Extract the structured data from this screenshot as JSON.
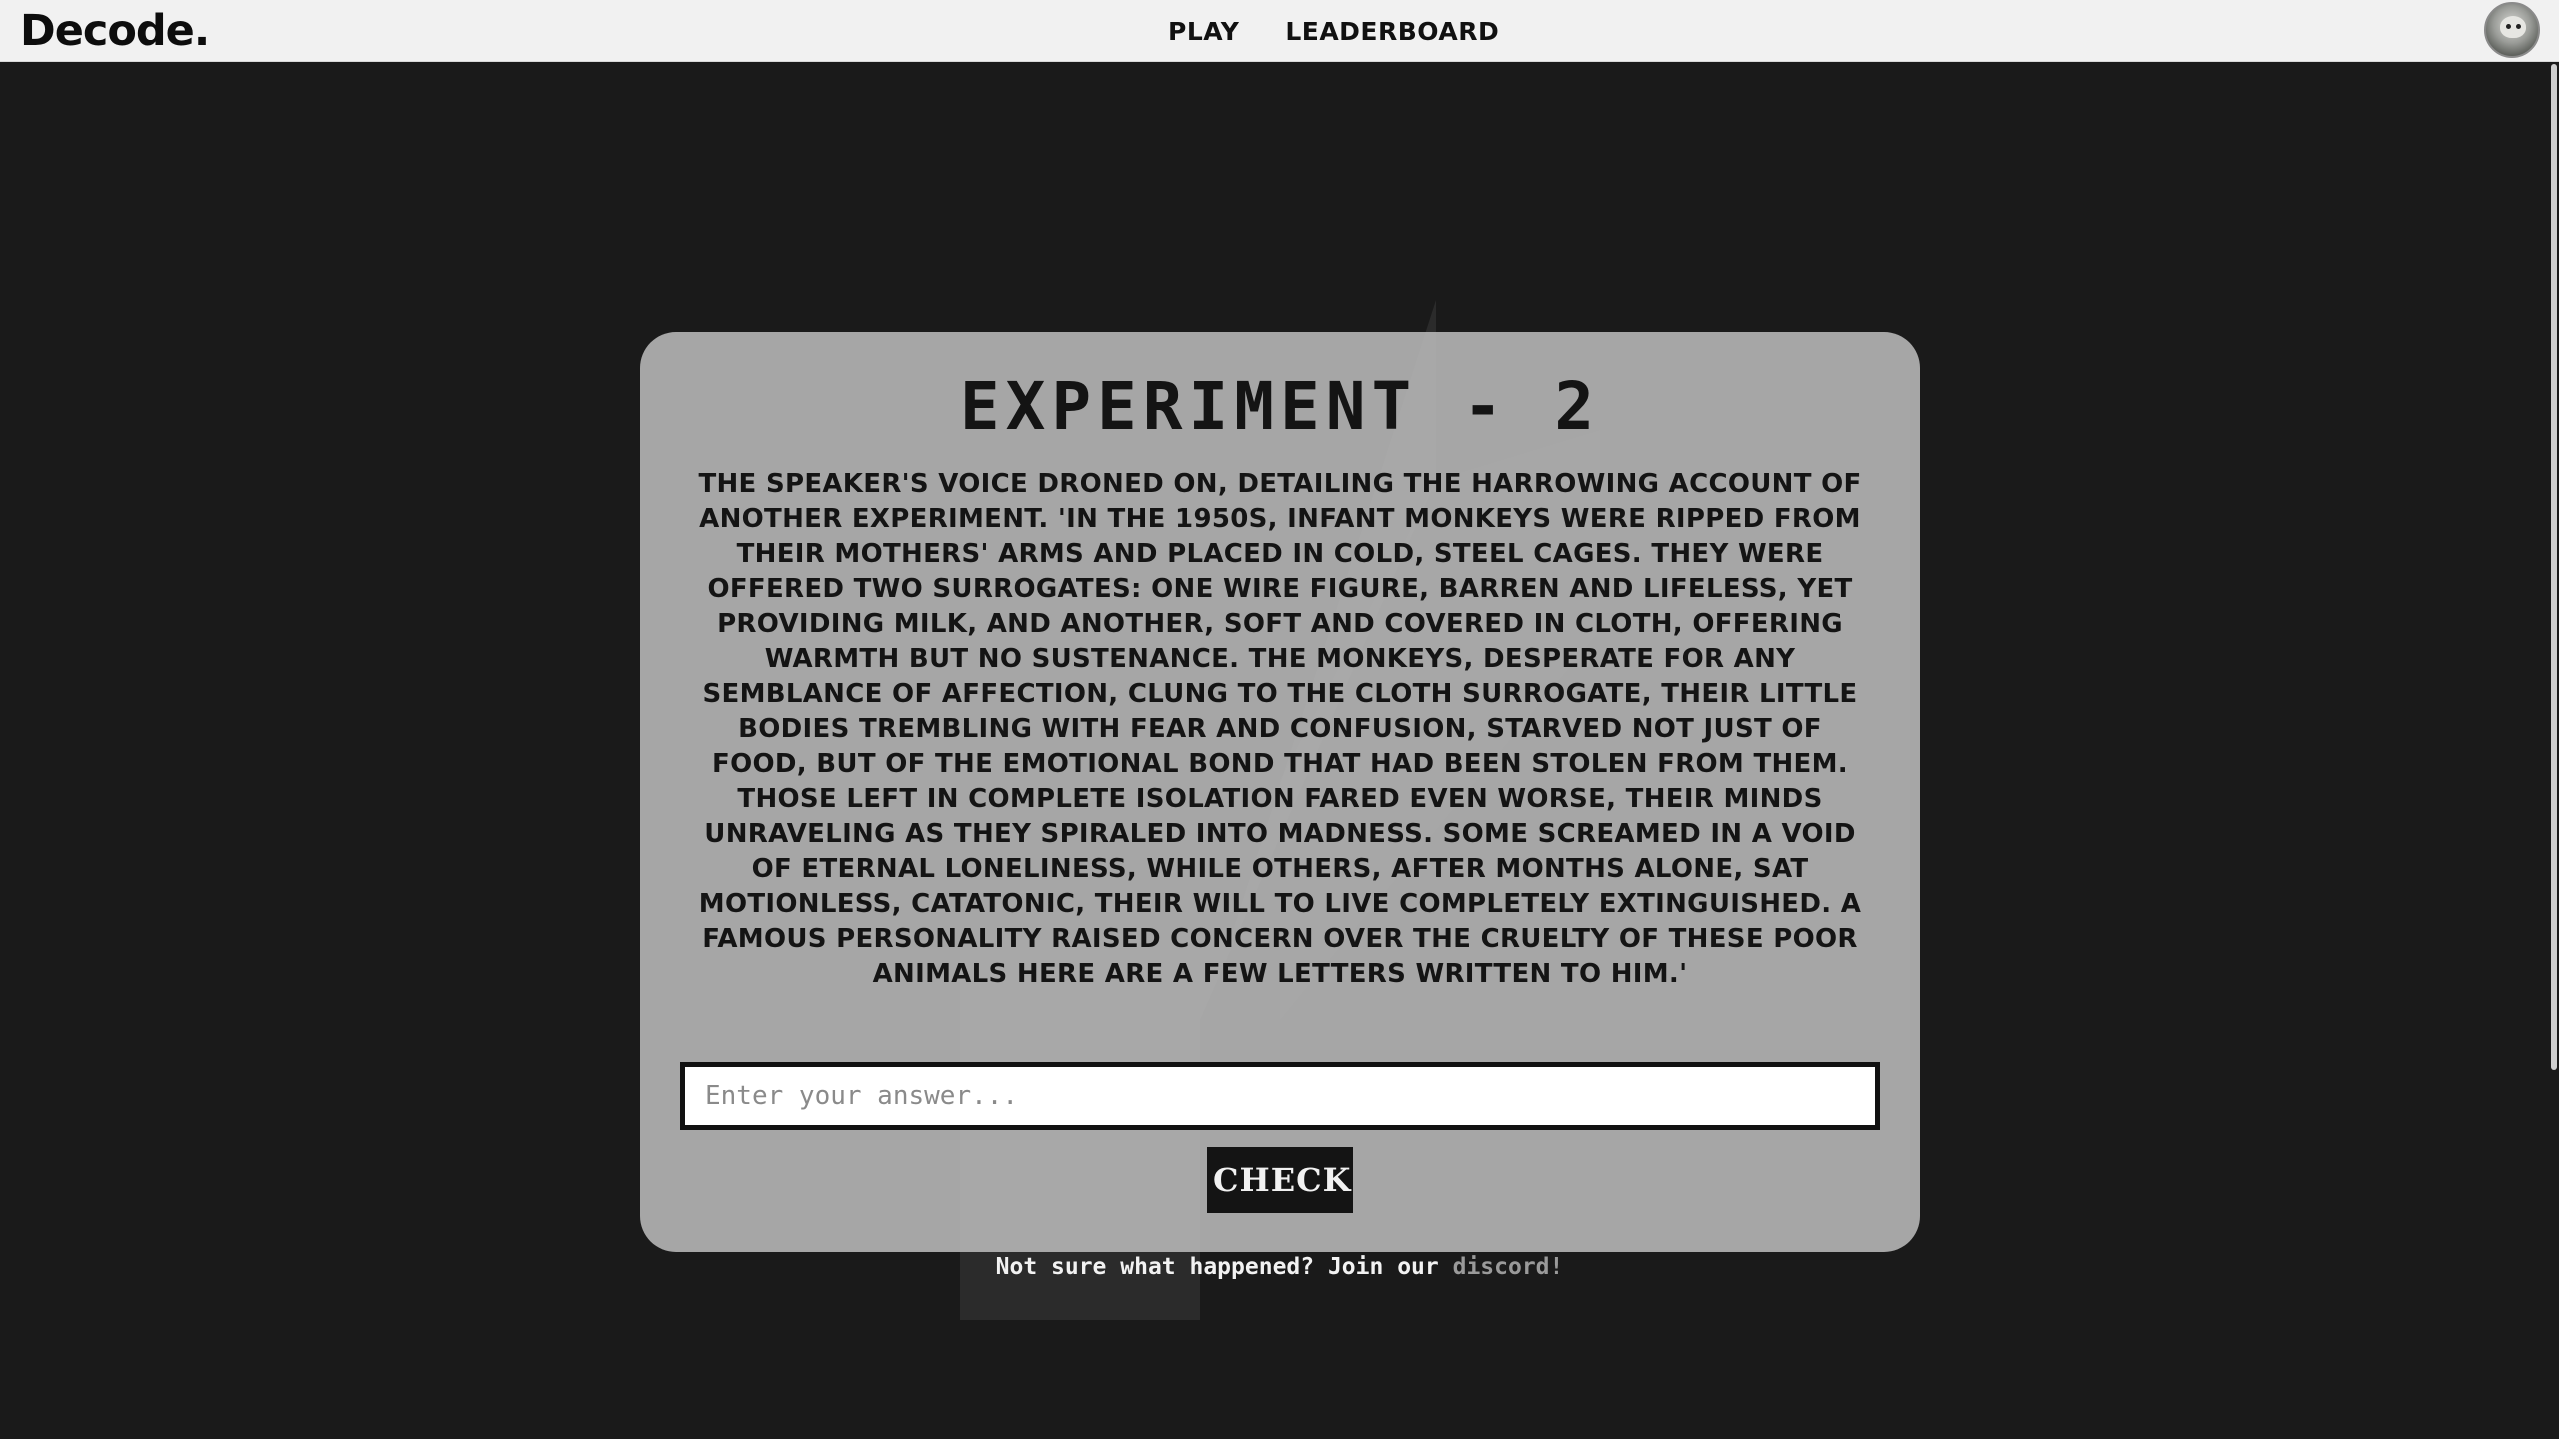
{
  "nav": {
    "logo": "Decode.",
    "links": [
      "PLAY",
      "LEADERBOARD"
    ]
  },
  "puzzle": {
    "title": "EXPERIMENT - 2",
    "story": "The speaker's voice droned on, detailing the harrowing account of another experiment. 'In the 1950s, infant monkeys were ripped from their mothers' arms and placed in cold, steel cages. They were offered two surrogates: one wire figure, barren and lifeless, yet providing milk, and another, soft and covered in cloth, offering warmth but no sustenance. The monkeys, desperate for any semblance of affection, clung to the cloth surrogate, their little bodies trembling with fear and confusion, starved not just of food, but of the emotional bond that had been stolen from them. Those left in complete isolation fared even worse, their minds unraveling as they spiraled into madness. Some screamed in a void of eternal loneliness, while others, after months alone, sat motionless, catatonic, their will to live completely extinguished. A famous personality raised concern over the cruelty of these poor animals here are a few letters written to him.'",
    "answer_placeholder": "Enter your answer...",
    "answer_value": "",
    "check_label": "CHECK"
  },
  "help": {
    "text": "Not sure what happened? Join our ",
    "link_text": "discord!"
  },
  "colors": {
    "background": "#1a1a1a",
    "navbar": "#f1f1f1",
    "card": "#b9b9b9",
    "button": "#141414",
    "link": "#9a9a9a"
  },
  "icons": {
    "avatar": "user-avatar-icon",
    "watermark": "lightning-bolt-icon"
  }
}
